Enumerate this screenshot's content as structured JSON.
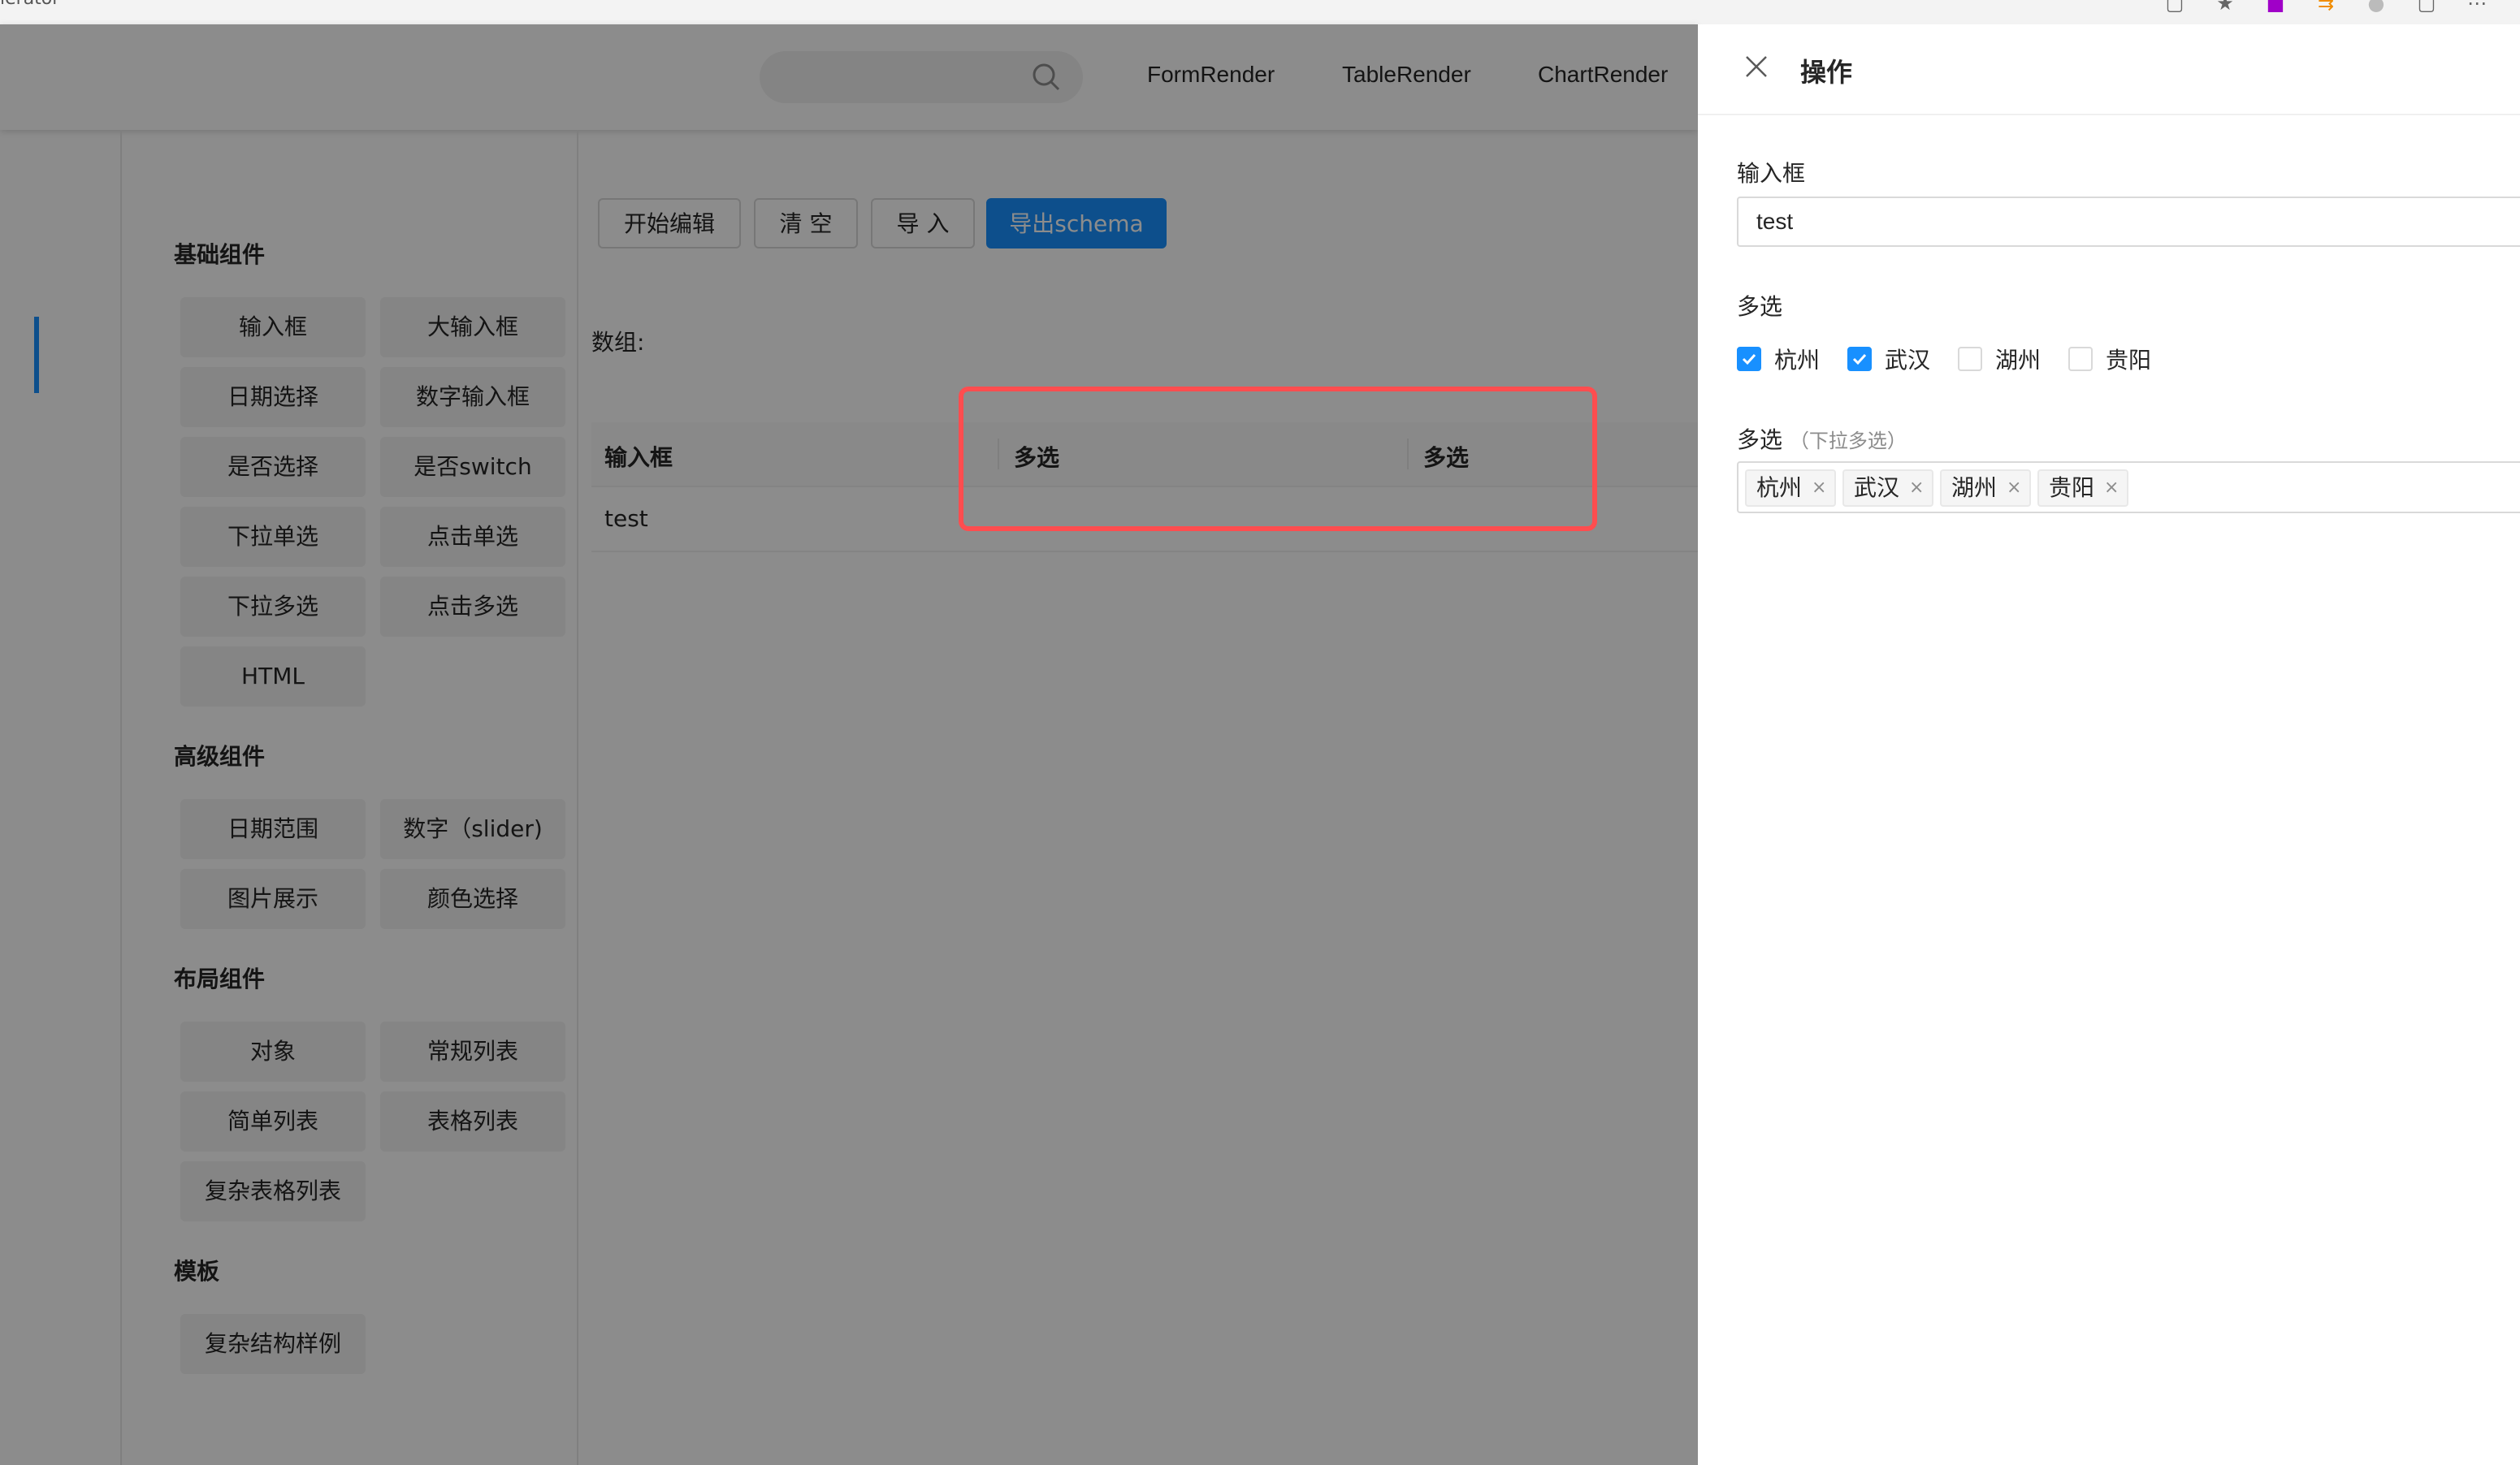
{
  "browser": {
    "title": "lerator"
  },
  "nav": {
    "links": [
      "FormRender",
      "TableRender",
      "ChartRender"
    ]
  },
  "widgets": {
    "groups": [
      {
        "title": "基础组件",
        "items": [
          "输入框",
          "大输入框",
          "日期选择",
          "数字输入框",
          "是否选择",
          "是否switch",
          "下拉单选",
          "点击单选",
          "下拉多选",
          "点击多选",
          "HTML"
        ]
      },
      {
        "title": "高级组件",
        "items": [
          "日期范围",
          "数字（slider)",
          "图片展示",
          "颜色选择"
        ]
      },
      {
        "title": "布局组件",
        "items": [
          "对象",
          "常规列表",
          "简单列表",
          "表格列表",
          "复杂表格列表"
        ]
      },
      {
        "title": "模板",
        "items": [
          "复杂结构样例"
        ]
      }
    ]
  },
  "toolbar": {
    "buttons": [
      "开始编辑",
      "清 空",
      "导 入",
      "导出schema"
    ]
  },
  "canvas": {
    "array_label": "数组:",
    "table": {
      "headers": [
        "输入框",
        "多选",
        "多选"
      ],
      "rows": [
        [
          "test",
          "",
          ""
        ]
      ]
    }
  },
  "drawer": {
    "title": "操作",
    "input_label": "输入框",
    "input_value": "test",
    "checkbox_label": "多选",
    "checkbox_options": [
      {
        "label": "杭州",
        "checked": true
      },
      {
        "label": "武汉",
        "checked": true
      },
      {
        "label": "湖州",
        "checked": false
      },
      {
        "label": "贵阳",
        "checked": false
      }
    ],
    "select_label": "多选",
    "select_note": "（下拉多选）",
    "select_tags": [
      "杭州",
      "武汉",
      "湖州",
      "贵阳"
    ],
    "tag_close": "×"
  },
  "colors": {
    "accent": "#1890ff",
    "highlight": "#ff4d4f"
  }
}
